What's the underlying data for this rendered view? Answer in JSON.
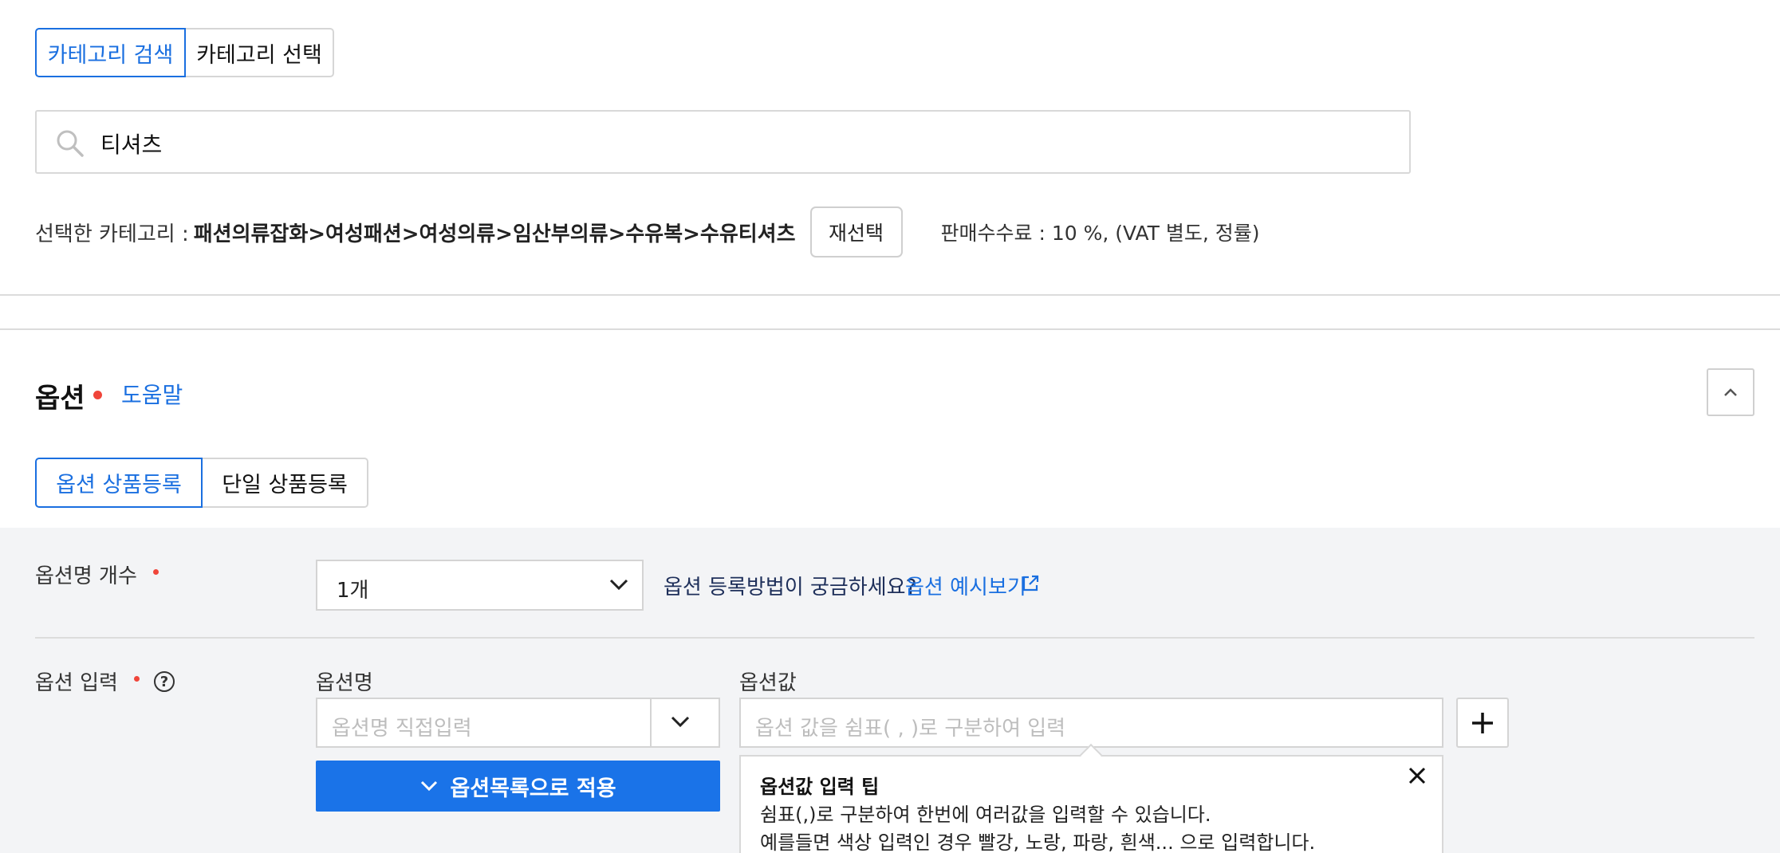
{
  "category": {
    "tabs": [
      {
        "label": "카테고리 검색",
        "active": true
      },
      {
        "label": "카테고리 선택",
        "active": false
      }
    ],
    "search": {
      "value": "티셔츠"
    },
    "selected_label": "선택한 카테고리 :",
    "selected_path": "패션의류잡화>여성패션>여성의류>임산부의류>수유복>수유티셔츠",
    "reselect_label": "재선택",
    "fee_text": "판매수수료 : 10 %, (VAT 별도, 정률)"
  },
  "option_section": {
    "title": "옵션",
    "help_label": "도움말",
    "tabs": [
      {
        "label": "옵션 상품등록",
        "active": true
      },
      {
        "label": "단일 상품등록",
        "active": false
      }
    ],
    "count_label": "옵션명 개수",
    "count_value": "1개",
    "howto_text": "옵션 등록방법이 궁금하세요?",
    "example_link": "옵션 예시보기",
    "input_label": "옵션 입력",
    "option_name_label": "옵션명",
    "option_name_placeholder": "옵션명 직접입력",
    "option_value_label": "옵션값",
    "option_value_placeholder": "옵션 값을 쉼표( , )로 구분하여 입력",
    "apply_label": "옵션목록으로 적용",
    "tip": {
      "title": "옵션값 입력 팁",
      "line1": "쉼표(,)로 구분하여 한번에 여러값을 입력할 수 있습니다.",
      "line2": "예를들면 색상 입력인 경우 빨강, 노랑, 파랑, 흰색... 으로 입력합니다."
    }
  },
  "colors": {
    "accent": "#1a6fe0",
    "required": "#f0453a",
    "panel_bg": "#f3f4f6"
  }
}
